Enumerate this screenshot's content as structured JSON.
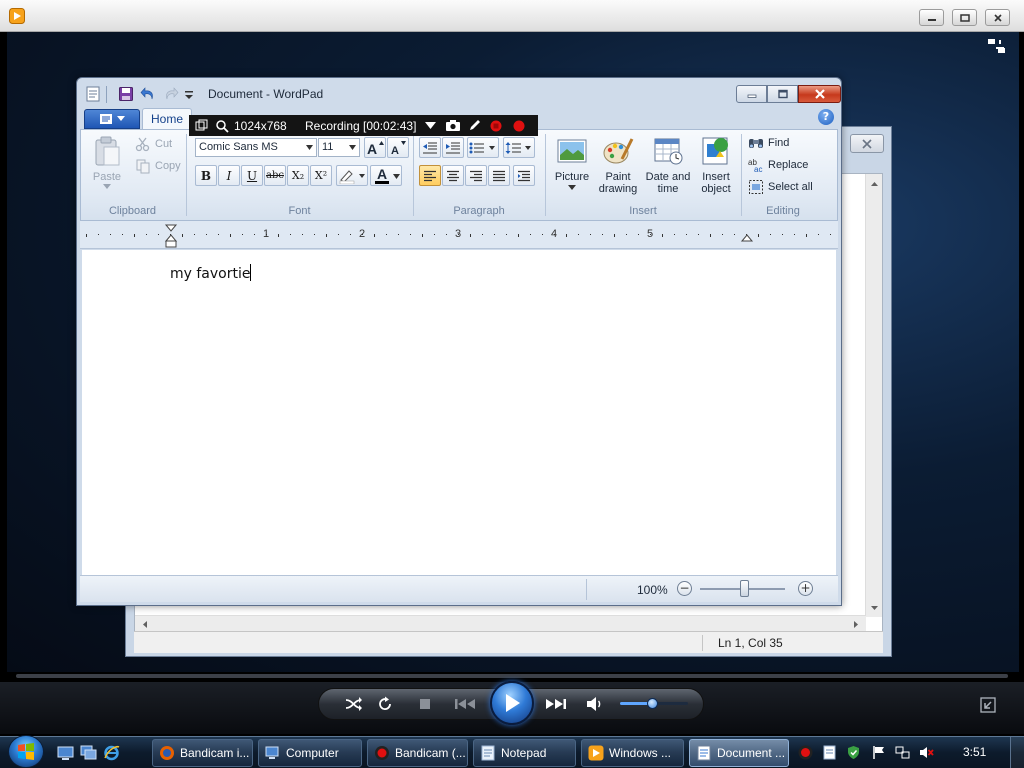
{
  "wordpad": {
    "title": "Document - WordPad",
    "tabs": [
      {
        "label": "Home",
        "active": true
      }
    ],
    "ribbon": {
      "clipboard": {
        "group_label": "Clipboard",
        "paste": "Paste",
        "cut": "Cut",
        "copy": "Copy"
      },
      "font": {
        "group_label": "Font",
        "family": "Comic Sans MS",
        "size": "11",
        "bold": "B",
        "italic": "I",
        "underline": "U",
        "strike": "abc",
        "subscript": "X₂",
        "superscript": "X²",
        "font_color_letter": "A"
      },
      "paragraph": {
        "group_label": "Paragraph"
      },
      "insert": {
        "group_label": "Insert",
        "picture": "Picture",
        "paint_line1": "Paint",
        "paint_line2": "drawing",
        "date_line1": "Date and",
        "date_line2": "time",
        "object_line1": "Insert",
        "object_line2": "object"
      },
      "editing": {
        "group_label": "Editing",
        "find": "Find",
        "replace": "Replace",
        "select_all": "Select all"
      }
    },
    "ruler": {
      "numbers": [
        "1",
        "2",
        "3",
        "4",
        "5"
      ]
    },
    "document": {
      "text": "my favortie"
    },
    "status": {
      "zoom": "100%",
      "zoom_out": "−",
      "zoom_in": "+"
    }
  },
  "notepad": {
    "status": "Ln 1, Col 35"
  },
  "bandicam": {
    "resolution": "1024x768",
    "recording": "Recording [00:02:43]"
  },
  "taskbar": {
    "buttons": [
      {
        "label": "Bandicam i..."
      },
      {
        "label": "Computer"
      },
      {
        "label": "Bandicam (..."
      },
      {
        "label": "Notepad"
      },
      {
        "label": "Windows ..."
      },
      {
        "label": "Document ..."
      }
    ],
    "clock": "3:51"
  },
  "colors": {
    "title_close": "#c6391c",
    "file_tab": "#1f56b4",
    "wmp_play": "#2f7ad6",
    "recording_red": "#e01010",
    "taskbar": "#0d1b2c"
  },
  "icons": {
    "wmp_app": "media-player-icon",
    "save": "save-icon",
    "undo": "undo-icon",
    "redo": "redo-icon",
    "paste": "clipboard-icon",
    "picture": "picture-icon",
    "paint": "paint-palette-icon",
    "date": "calendar-icon",
    "object": "insert-object-icon",
    "find": "binoculars-icon",
    "start": "windows-start-icon"
  }
}
